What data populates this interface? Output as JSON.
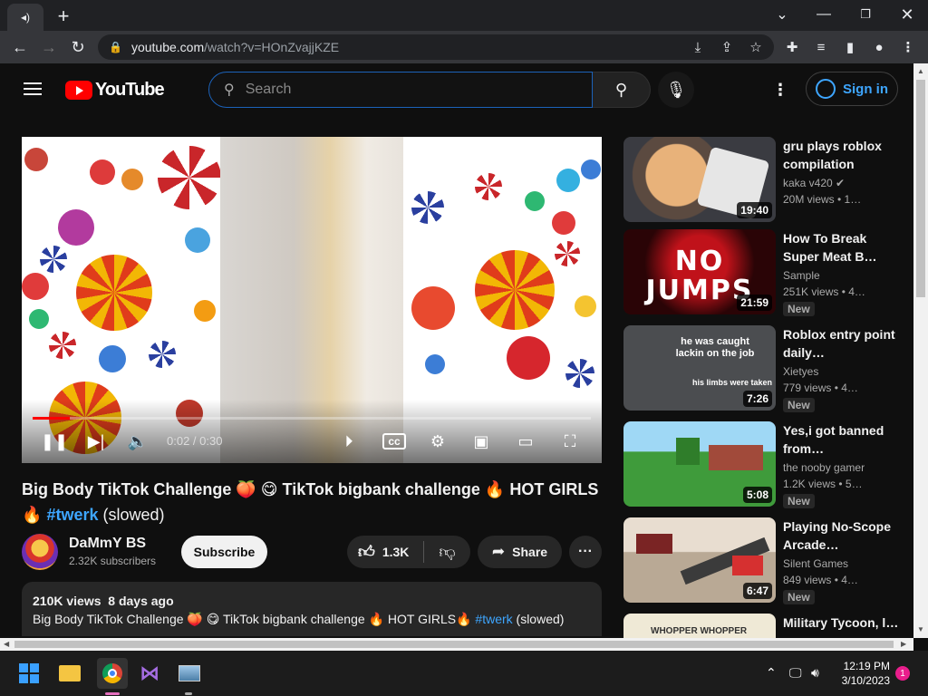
{
  "browser": {
    "url_domain": "youtube.com",
    "url_path": "/watch?v=HOnZvajjKZE",
    "tab_icon": "speaker-icon"
  },
  "yt": {
    "logo_text": "YouTube",
    "search_placeholder": "Search",
    "signin": "Sign in"
  },
  "player": {
    "time": "0:02 / 0:30",
    "progress_fraction": 0.067
  },
  "video": {
    "title_main": "Big Body TikTok Challenge 🍑 😋 TikTok bigbank challenge 🔥 HOT GIRLS 🔥",
    "title_tag": "#twerk",
    "title_tail": "(slowed)",
    "channel": "DaMmY BS",
    "subscribers": "2.32K subscribers",
    "subscribe": "Subscribe",
    "likes": "1.3K",
    "share": "Share",
    "views": "210K views",
    "date": "8 days ago",
    "desc_main": "Big Body TikTok Challenge 🍑 😋 TikTok bigbank challenge 🔥 HOT GIRLS🔥",
    "desc_tag": "#twerk",
    "desc_tail": "(slowed)"
  },
  "recommended": [
    {
      "title": "gru plays roblox compilation",
      "channel": "kaka v420",
      "meta": "20M views  • 1…",
      "duration": "19:40",
      "badge": ""
    },
    {
      "title": "How To Break Super Meat B…",
      "channel": "Sample",
      "meta": "251K views  • 4…",
      "duration": "21:59",
      "badge": "New"
    },
    {
      "title": "Roblox entry point daily…",
      "channel": "Xietyes",
      "meta": "779 views  • 4…",
      "duration": "7:26",
      "badge": "New"
    },
    {
      "title": "Yes,i got banned from…",
      "channel": "the nooby gamer",
      "meta": "1.2K views  • 5…",
      "duration": "5:08",
      "badge": "New"
    },
    {
      "title": "Playing No-Scope Arcade…",
      "channel": "Silent Games",
      "meta": "849 views  • 4…",
      "duration": "6:47",
      "badge": "New"
    },
    {
      "title": "Military Tycoon, l…",
      "channel": "",
      "meta": "",
      "duration": "",
      "badge": ""
    }
  ],
  "thumb_text": {
    "rec1": "NO JUMPS",
    "rec2_line1": "he was caught",
    "rec2_line2": "lackin on the job",
    "rec2_line3": "his limbs were taken",
    "rec5": "WHOPPER WHOPPER"
  },
  "taskbar": {
    "time": "12:19 PM",
    "date": "3/10/2023",
    "notifications": "1"
  }
}
